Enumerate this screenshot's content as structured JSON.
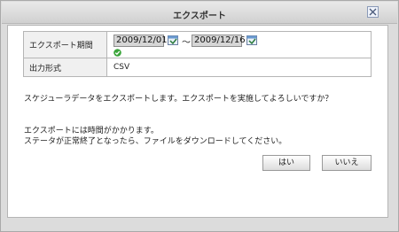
{
  "dialog": {
    "title": "エクスポート",
    "close_label": "×"
  },
  "form": {
    "period_label": "エクスポート期間",
    "date_from": "2009/12/01",
    "date_separator": "～",
    "date_to": "2009/12/16",
    "format_label": "出力形式",
    "format_value": "CSV"
  },
  "messages": {
    "confirm": "スケジューラデータをエクスポートします。エクスポートを実施してよろしいですか？",
    "note_line1": "エクスポートには時間がかかります。",
    "note_line2": "ステータが正常終了となったら、ファイルをダウンロードしてください。"
  },
  "buttons": {
    "yes": "はい",
    "no": "いいえ"
  },
  "icons": {
    "calendar": "calendar-icon",
    "valid": "check-circle-icon",
    "close": "close-icon"
  },
  "colors": {
    "check_green": "#3aa53a",
    "label_bg": "#f0f0f0"
  }
}
